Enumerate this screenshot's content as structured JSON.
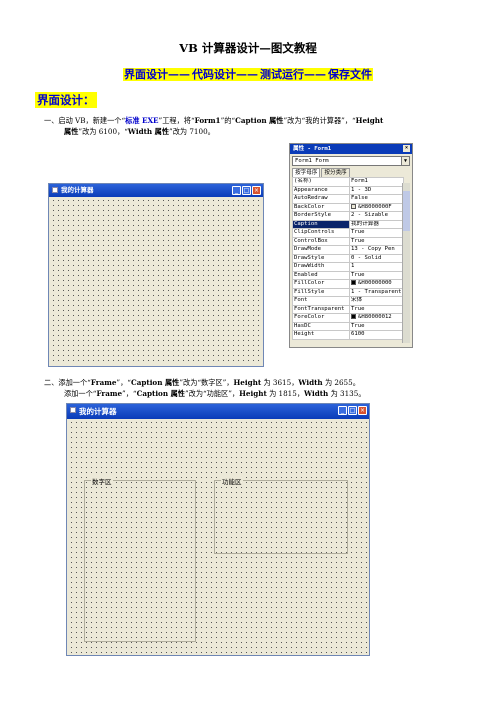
{
  "title": "VB 计算器设计—图文教程",
  "steps": [
    "界面设计——",
    "代码设计——",
    "测试运行——",
    "保存文件"
  ],
  "section_heading": "界面设计：",
  "step1": {
    "prefix": "一、启动 VB，新建一个“",
    "kw1": "标准 EXE",
    "mid1": "”工程，将“",
    "kw2": "Form1",
    "mid2": "”的“",
    "kw3": "Caption 属性",
    "mid3": "”改为“我的计算器”，“",
    "kw4": "Height",
    "line2_kw": "属性",
    "line2_a": "”改为 6100，“",
    "kw5": "Width 属性",
    "line2_b": "”改为 7100。"
  },
  "form1": {
    "title": "我的计算器"
  },
  "properties": {
    "title": "属性 - Form1",
    "object": "Form1 Form",
    "tabs": [
      "按字母序",
      "按分类序"
    ],
    "rows": [
      [
        "(名称)",
        "Form1"
      ],
      [
        "Appearance",
        "1 - 3D"
      ],
      [
        "AutoRedraw",
        "False"
      ],
      [
        "BackColor",
        "&H8000000F"
      ],
      [
        "BorderStyle",
        "2 - Sizable"
      ],
      [
        "Caption",
        "我的计算器"
      ],
      [
        "ClipControls",
        "True"
      ],
      [
        "ControlBox",
        "True"
      ],
      [
        "DrawMode",
        "13 - Copy Pen"
      ],
      [
        "DrawStyle",
        "0 - Solid"
      ],
      [
        "DrawWidth",
        "1"
      ],
      [
        "Enabled",
        "True"
      ],
      [
        "FillColor",
        "&H00000000"
      ],
      [
        "FillStyle",
        "1 - Transparent"
      ],
      [
        "Font",
        "宋体"
      ],
      [
        "FontTransparent",
        "True"
      ],
      [
        "ForeColor",
        "&H80000012"
      ],
      [
        "HasDC",
        "True"
      ],
      [
        "Height",
        "6100"
      ]
    ],
    "selected_row": "Caption",
    "colors": {
      "BackColor": "#ece9d8",
      "FillColor": "#000000",
      "ForeColor": "#000000"
    }
  },
  "step2": {
    "line1_a": "二、添加一个“",
    "line1_kw1": "Frame",
    "line1_b": "”，“",
    "line1_kw2": "Caption 属性",
    "line1_c": "”改为“数字区”，",
    "line1_kw3": "Height",
    "line1_d": " 为 3615，",
    "line1_kw4": "Width",
    "line1_e": " 为 2655。",
    "line2_a": "添加一个“",
    "line2_kw1": "Frame",
    "line2_b": "”，“",
    "line2_kw2": "Caption 属性",
    "line2_c": "”改为“功能区”，",
    "line2_kw3": "Height",
    "line2_d": " 为 1815，",
    "line2_kw4": "Width",
    "line2_e": " 为 3135。"
  },
  "form2": {
    "title": "我的计算器",
    "frame_digits": "数字区",
    "frame_functions": "功能区"
  }
}
